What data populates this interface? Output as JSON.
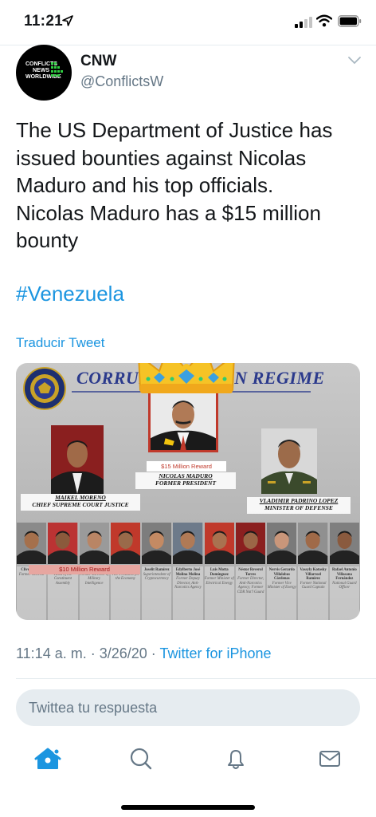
{
  "status_bar": {
    "time": "11:21"
  },
  "tweet": {
    "display_name": "CNW",
    "handle": "@ConflictsW",
    "avatar_text": [
      "CONFLICTS",
      "NEWS",
      "WORLDWIDE"
    ],
    "text": "The US Department of Justice has\nissued bounties against Nicolas\nMaduro and his top officials.\nNicolas Maduro has a $15 million\nbounty",
    "hashtag": "#Venezuela",
    "translate_label": "Traducir Tweet",
    "timestamp": "11:14 a. m. · 3/26/20 · ",
    "source": "Twitter for iPhone"
  },
  "media": {
    "headline_left": "CORRUP",
    "headline_right": "N REGIME",
    "maduro": {
      "reward": "$15 Million Reward",
      "name": "NICOLAS MADURO",
      "title": "FORMER PRESIDENT"
    },
    "moreno": {
      "name": "MAIKEL MORENO",
      "title": "CHIEF SUPREME COURT JUSTICE"
    },
    "padrino": {
      "name": "VLADIMIR PADRINO LOPEZ",
      "title": "MINISTER OF DEFENSE"
    },
    "reward_10": "$10 Million Reward",
    "officials": [
      {
        "name": "Clíver Alcalá",
        "role": "Former General"
      },
      {
        "name": "Diosdado Cabello",
        "role": "Head of the Constituent Assembly"
      },
      {
        "name": "Hugo Carvajal",
        "role": "Former Director of Military Intelligence"
      },
      {
        "name": "Tareck El Aissami",
        "role": "Vice President for the Economy"
      },
      {
        "name": "Joselit Ramírez",
        "role": "Superintendent of Cryptocurrency"
      },
      {
        "name": "Edylberto José Molina Molina",
        "role": "Former Deputy Director, Anti-Narcotics Agency"
      },
      {
        "name": "Luis Motta Domínguez",
        "role": "Former Minister of Electrical Energy"
      },
      {
        "name": "Néstor Reverol Torres",
        "role": "Former Director, Anti-Narcotics Agency; Former CDR Nat'l Guard"
      },
      {
        "name": "Nervis Gerardo Villalobos Cárdenas",
        "role": "Former Vice Minister of Energy"
      },
      {
        "name": "Vassyly Kotosky Villarroel Ramírez",
        "role": "Former National Guard Captain"
      },
      {
        "name": "Rafael Antonio Villasana Fernández",
        "role": "National Guard Officer"
      }
    ]
  },
  "reply_box": {
    "placeholder": "Twittea tu respuesta"
  },
  "tabs": [
    {
      "icon": "home-icon",
      "active": true
    },
    {
      "icon": "search-icon",
      "active": false
    },
    {
      "icon": "notifications-bell-icon",
      "active": false
    },
    {
      "icon": "messages-envelope-icon",
      "active": false
    }
  ],
  "colors": {
    "accent": "#1b95e0",
    "text": "#14171a",
    "secondary": "#657786",
    "divider": "#e6ecf0"
  }
}
